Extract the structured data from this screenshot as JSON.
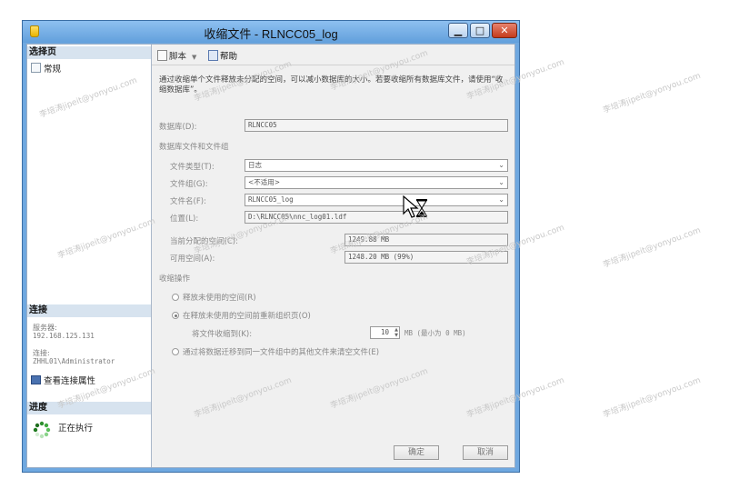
{
  "window": {
    "title": "收缩文件 - RLNCC05_log",
    "min": "▁",
    "max": "□",
    "close": "✕"
  },
  "left": {
    "select_page_header": "选择页",
    "general": "常规",
    "connection_header": "连接",
    "server_label": "服务器:",
    "server_value": "192.168.125.131",
    "conn_label": "连接:",
    "conn_value": "ZHHL01\\Administrator",
    "view_conn_props": "查看连接属性",
    "progress_header": "进度",
    "progress_status": "正在执行"
  },
  "toolbar": {
    "script": "脚本",
    "help": "帮助"
  },
  "main": {
    "description": "通过收缩单个文件释放未分配的空间，可以减小数据库的大小。若要收缩所有数据库文件，请使用“收缩数据库”。",
    "database_label": "数据库(D):",
    "database_value": "RLNCC05",
    "files_group_label": "数据库文件和文件组",
    "file_type_label": "文件类型(T):",
    "file_type_value": "日志",
    "filegroup_label": "文件组(G):",
    "filegroup_value": "<不适用>",
    "filename_label": "文件名(F):",
    "filename_value": "RLNCC05_log",
    "location_label": "位置(L):",
    "location_value": "D:\\RLNCC05\\nnc_log01.ldf",
    "allocated_label": "当前分配的空间(C):",
    "allocated_value": "1249.88 MB",
    "available_label": "可用空间(A):",
    "available_value": "1248.20 MB (99%)",
    "shrink_action_label": "收缩操作",
    "opt_release": "释放未使用的空间(R)",
    "opt_reorganize": "在释放未使用的空间前重新组织页(O)",
    "shrink_to_label": "将文件收缩到(K):",
    "shrink_to_value": "10",
    "shrink_to_hint": "MB (最小为 0 MB)",
    "opt_empty": "通过将数据迁移到同一文件组中的其他文件来清空文件(E)"
  },
  "buttons": {
    "ok": "确定",
    "cancel": "取消"
  },
  "watermark": "李培涛jipeit@yonyou.com"
}
